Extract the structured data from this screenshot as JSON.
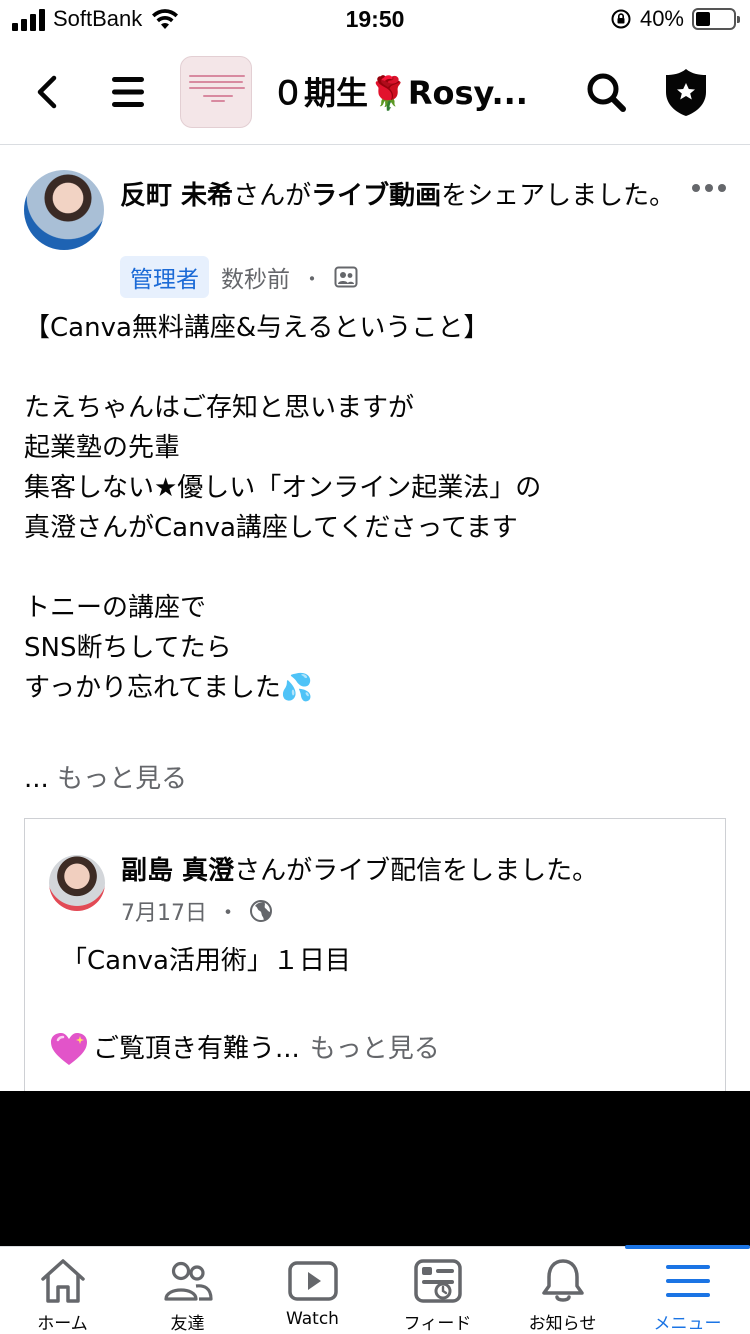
{
  "status_bar": {
    "carrier": "SoftBank",
    "time": "19:50",
    "battery": "40%",
    "battery_level": 0.4
  },
  "group": {
    "title": "０期生🌹Rosy..."
  },
  "post": {
    "author": "反町 未希",
    "action_prefix": "さんが",
    "action_object": "ライブ動画",
    "action_suffix": "をシェアしました。",
    "badge": "管理者",
    "time": "数秒前",
    "separator": "・",
    "body": "【Canva無料講座&与えるということ】\n\nたえちゃんはご存知と思いますが\n起業塾の先輩\n集客しない★優しい「オンライン起業法」の\n真澄さんがCanva講座してくださってます\n\nトニーの講座で\nSNS断ちしてたら\nすっかり忘れてました💦",
    "see_more_ellipsis": "...",
    "see_more": "もっと見る"
  },
  "shared": {
    "author": "副島 真澄",
    "action": "さんがライブ配信をしました。",
    "date": "7月17日",
    "separator": "・",
    "body": "「Canva活用術」１日目",
    "preview": "ご覧頂き有難う...",
    "see_more": "もっと見る"
  },
  "tabs": [
    {
      "label": "ホーム",
      "icon": "home-icon"
    },
    {
      "label": "友達",
      "icon": "friends-icon"
    },
    {
      "label": "Watch",
      "icon": "watch-icon"
    },
    {
      "label": "フィード",
      "icon": "feed-icon"
    },
    {
      "label": "お知らせ",
      "icon": "bell-icon"
    },
    {
      "label": "メニュー",
      "icon": "menu-icon",
      "active": true
    }
  ],
  "colors": {
    "accent": "#1b74e4",
    "secondary_text": "#65676b",
    "admin_badge_bg": "#e7f0fd"
  }
}
